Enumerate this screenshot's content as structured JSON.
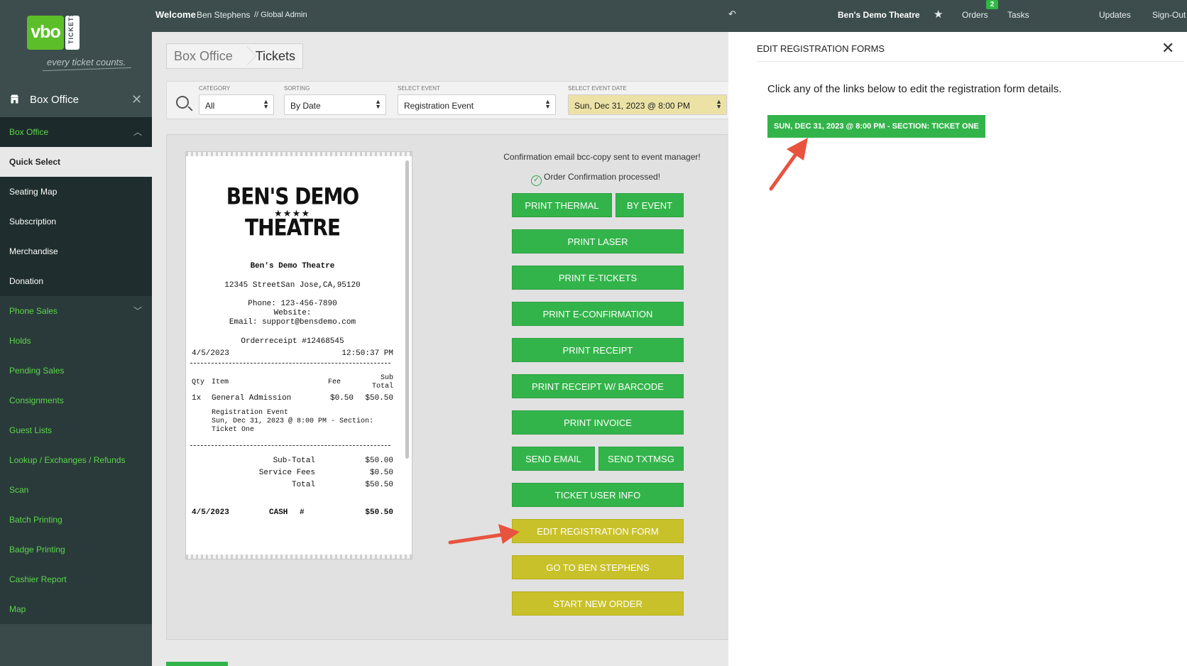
{
  "topbar": {
    "welcome": "Welcome",
    "user": "Ben Stephens",
    "role": "// Global Admin",
    "back_icon": "reply-arrow-icon",
    "venue": "Ben's Demo Theatre",
    "orders": "Orders",
    "orders_count": "2",
    "tasks": "Tasks",
    "updates": "Updates",
    "signout": "Sign-Out"
  },
  "brand": {
    "logo_text": "vbo",
    "logo_side": "TICKETS",
    "tagline": "every ticket counts.",
    "green": "#5cbf2a"
  },
  "sidebar": {
    "header": "Box Office",
    "items": [
      {
        "label": "Box Office",
        "type": "section"
      },
      {
        "label": "Quick Select",
        "type": "selected"
      },
      {
        "label": "Seating Map",
        "type": "item"
      },
      {
        "label": "Subscription",
        "type": "item"
      },
      {
        "label": "Merchandise",
        "type": "item"
      },
      {
        "label": "Donation",
        "type": "item"
      },
      {
        "label": "Phone Sales",
        "type": "section"
      },
      {
        "label": "Holds",
        "type": "green"
      },
      {
        "label": "Pending Sales",
        "type": "green"
      },
      {
        "label": "Consignments",
        "type": "green"
      },
      {
        "label": "Guest Lists",
        "type": "green"
      },
      {
        "label": "Lookup / Exchanges / Refunds",
        "type": "green"
      },
      {
        "label": "Scan",
        "type": "green"
      },
      {
        "label": "Batch Printing",
        "type": "green"
      },
      {
        "label": "Badge Printing",
        "type": "green"
      },
      {
        "label": "Cashier Report",
        "type": "green"
      },
      {
        "label": "Map",
        "type": "green"
      }
    ]
  },
  "breadcrumb": [
    "Box Office",
    "Tickets"
  ],
  "filters": {
    "category": {
      "caption": "CATEGORY",
      "value": "All"
    },
    "sorting": {
      "caption": "SORTING",
      "value": "By Date"
    },
    "event": {
      "caption": "SELECT EVENT",
      "value": "Registration Event"
    },
    "date": {
      "caption": "SELECT EVENT DATE",
      "value": "Sun, Dec 31, 2023 @ 8:00 PM"
    }
  },
  "receipt": {
    "logo_line1": "BEN'S DEMO",
    "logo_stars": "★★★★",
    "logo_line2": "THEATRE",
    "venue": "Ben's Demo Theatre",
    "address": "12345 StreetSan Jose,CA,95120",
    "phone": "Phone: 123-456-7890",
    "website": "Website:",
    "email": "Email: support@bensdemo.com",
    "order": "Orderreceipt #12468545",
    "date": "4/5/2023",
    "time": "12:50:37 PM",
    "col_qty": "Qty",
    "col_item": "Item",
    "col_fee": "Fee",
    "col_sub1": "Sub",
    "col_sub2": "Total",
    "line_qty": "1x",
    "line_item": "General Admission",
    "line_fee": "$0.50",
    "line_total": "$50.50",
    "line_desc1": "Registration Event",
    "line_desc2": "Sun, Dec 31, 2023 @ 8:00 PM - Section:",
    "line_desc3": "Ticket One",
    "subtotal_label": "Sub-Total",
    "subtotal": "$50.00",
    "fees_label": "Service Fees",
    "fees": "$0.50",
    "total_label": "Total",
    "total": "$50.50",
    "pay_date": "4/5/2023",
    "pay_method": "CASH",
    "pay_hash": "#",
    "pay_amount": "$50.50"
  },
  "messages": {
    "bcc": "Confirmation email bcc-copy sent to event manager!",
    "processed": "Order Confirmation processed!"
  },
  "buttons": {
    "print_thermal": "PRINT THERMAL",
    "by_event": "BY EVENT",
    "print_laser": "PRINT LASER",
    "print_etickets": "PRINT E-TICKETS",
    "print_econf": "PRINT E-CONFIRMATION",
    "print_receipt": "PRINT RECEIPT",
    "print_receipt_barcode": "PRINT RECEIPT W/ BARCODE",
    "print_invoice": "PRINT INVOICE",
    "send_email": "SEND EMAIL",
    "send_txt": "SEND TXTMSG",
    "ticket_user": "TICKET USER INFO",
    "edit_reg": "EDIT REGISTRATION FORM",
    "go_to": "GO TO BEN STEPHENS",
    "new_order": "START NEW ORDER",
    "green": "#33b44a",
    "yellow": "#c9c12a"
  },
  "drawer": {
    "title": "EDIT REGISTRATION FORMS",
    "instructions": "Click any of the links below to edit the registration form details.",
    "link": "SUN, DEC 31, 2023 @ 8:00 PM - SECTION: TICKET ONE"
  },
  "annotation_color": "#e8533f"
}
